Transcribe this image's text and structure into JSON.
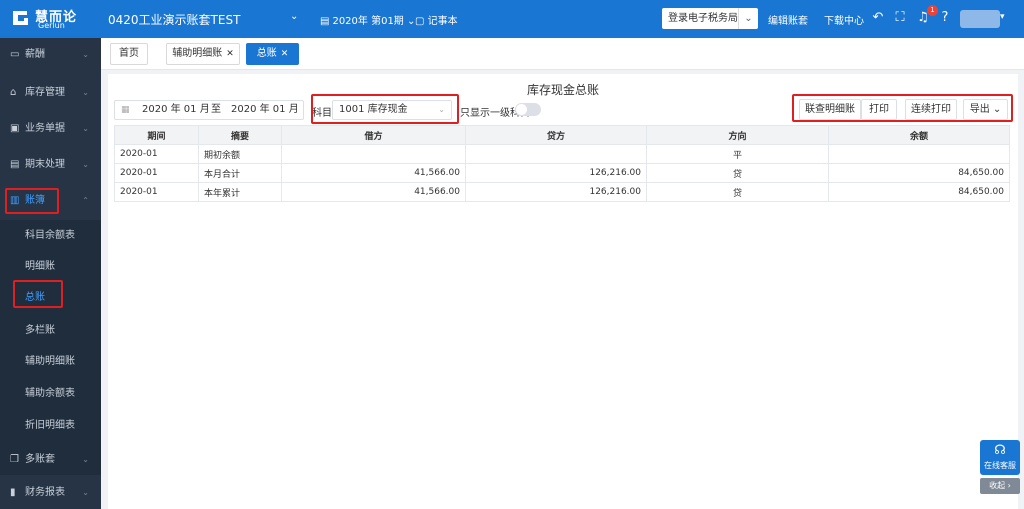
{
  "topbar": {
    "logo_cn": "慧而论",
    "logo_en": "Gerlun",
    "account_name": "0420工业演示账套TEST",
    "period": "2020年 第01期",
    "note": "记事本",
    "login_tax": "登录电子税务局",
    "edit_account": "编辑账套",
    "download_center": "下载中心",
    "notification_count": "1"
  },
  "sidebar": {
    "items": [
      {
        "label": "薪酬",
        "icon": "wallet-icon"
      },
      {
        "label": "库存管理",
        "icon": "home-icon"
      },
      {
        "label": "业务单据",
        "icon": "document-icon"
      },
      {
        "label": "期末处理",
        "icon": "calculator-icon"
      },
      {
        "label": "账簿",
        "icon": "book-icon"
      },
      {
        "label": "多账套",
        "icon": "copy-icon"
      },
      {
        "label": "财务报表",
        "icon": "bar-chart-icon"
      }
    ],
    "sub_items": [
      "科目余额表",
      "明细账",
      "总账",
      "多栏账",
      "辅助明细账",
      "辅助余额表",
      "折旧明细表"
    ]
  },
  "tabs": [
    {
      "label": "首页"
    },
    {
      "label": "辅助明细账"
    },
    {
      "label": "总账"
    }
  ],
  "report": {
    "title": "库存现金总账",
    "date_from": "2020 年 01 月",
    "date_to_sep": "至",
    "date_to": "2020 年 01 月",
    "subject_label": "科目",
    "subject_value": "1001 库存现金",
    "level1_label": "只显示一级科目",
    "buttons": {
      "linked_detail": "联查明细账",
      "print": "打印",
      "continuous_print": "连续打印",
      "export": "导出"
    }
  },
  "table": {
    "headers": [
      "期间",
      "摘要",
      "借方",
      "贷方",
      "方向",
      "余额"
    ],
    "rows": [
      [
        "2020-01",
        "期初余额",
        "",
        "",
        "平",
        ""
      ],
      [
        "2020-01",
        "本月合计",
        "41,566.00",
        "126,216.00",
        "贷",
        "84,650.00"
      ],
      [
        "2020-01",
        "本年累计",
        "41,566.00",
        "126,216.00",
        "贷",
        "84,650.00"
      ]
    ]
  },
  "service": {
    "online_label": "在线客服",
    "collapse_label": "收起 ›"
  },
  "colors": {
    "brand_blue": "#1976d2",
    "sidebar_bg": "#263445",
    "highlight_red": "#e02020",
    "active_link": "#409eff"
  }
}
